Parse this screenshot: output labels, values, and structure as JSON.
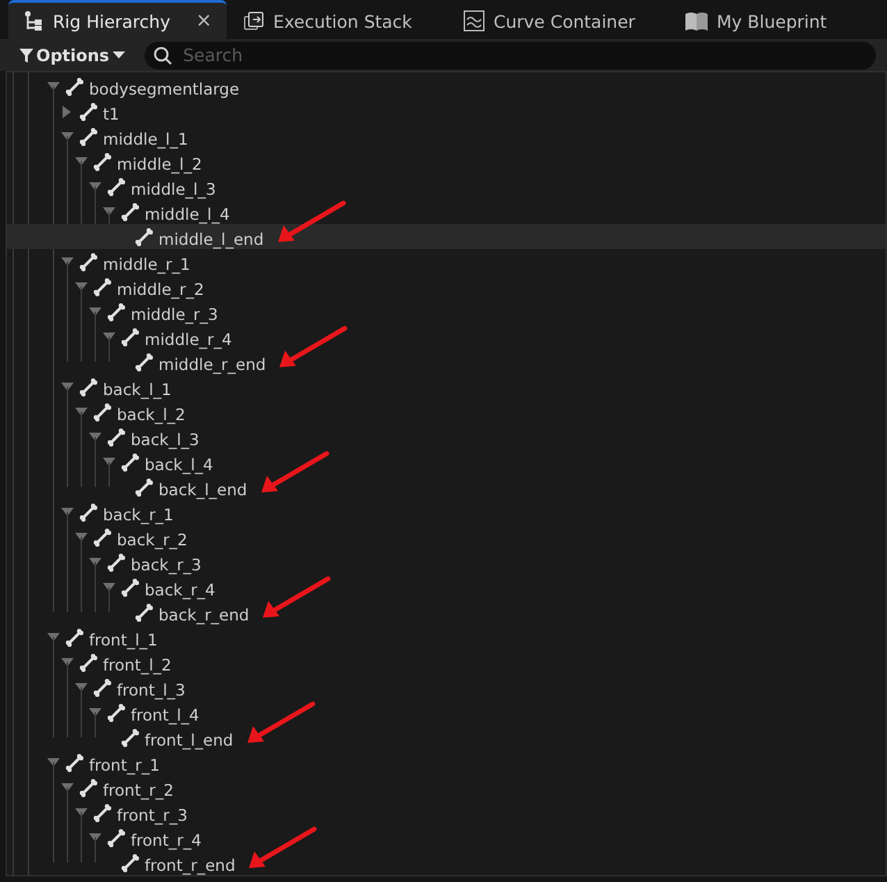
{
  "tabs": [
    {
      "label": "Rig Hierarchy",
      "selected": true,
      "close": "×"
    },
    {
      "label": "Execution Stack",
      "selected": false
    },
    {
      "label": "Curve Container",
      "selected": false
    },
    {
      "label": "My Blueprint",
      "selected": false
    }
  ],
  "toolbar": {
    "options": "Options",
    "search": {
      "placeholder": "Search"
    }
  },
  "tree": [
    {
      "label": "bodysegmentlarge",
      "expanded": true,
      "children": [
        {
          "label": "t1",
          "expanded": false
        },
        {
          "label": "middle_l_1",
          "expanded": true,
          "children": [
            {
              "label": "middle_l_2",
              "expanded": true,
              "children": [
                {
                  "label": "middle_l_3",
                  "expanded": true,
                  "children": [
                    {
                      "label": "middle_l_4",
                      "expanded": true,
                      "children": [
                        {
                          "label": "middle_l_end",
                          "selected": true,
                          "marked": true
                        }
                      ]
                    }
                  ]
                }
              ]
            }
          ]
        },
        {
          "label": "middle_r_1",
          "expanded": true,
          "children": [
            {
              "label": "middle_r_2",
              "expanded": true,
              "children": [
                {
                  "label": "middle_r_3",
                  "expanded": true,
                  "children": [
                    {
                      "label": "middle_r_4",
                      "expanded": true,
                      "children": [
                        {
                          "label": "middle_r_end",
                          "selected": false,
                          "marked": true
                        }
                      ]
                    }
                  ]
                }
              ]
            }
          ]
        },
        {
          "label": "back_l_1",
          "expanded": true,
          "children": [
            {
              "label": "back_l_2",
              "expanded": true,
              "children": [
                {
                  "label": "back_l_3",
                  "expanded": true,
                  "children": [
                    {
                      "label": "back_l_4",
                      "expanded": true,
                      "children": [
                        {
                          "label": "back_l_end",
                          "selected": false,
                          "marked": true
                        }
                      ]
                    }
                  ]
                }
              ]
            }
          ]
        },
        {
          "label": "back_r_1",
          "expanded": true,
          "children": [
            {
              "label": "back_r_2",
              "expanded": true,
              "children": [
                {
                  "label": "back_r_3",
                  "expanded": true,
                  "children": [
                    {
                      "label": "back_r_4",
                      "expanded": true,
                      "children": [
                        {
                          "label": "back_r_end",
                          "selected": false,
                          "marked": true
                        }
                      ]
                    }
                  ]
                }
              ]
            }
          ]
        }
      ]
    },
    {
      "label": "front_l_1",
      "expanded": true,
      "children": [
        {
          "label": "front_l_2",
          "expanded": true,
          "children": [
            {
              "label": "front_l_3",
              "expanded": true,
              "children": [
                {
                  "label": "front_l_4",
                  "expanded": true,
                  "children": [
                    {
                      "label": "front_l_end",
                      "selected": false,
                      "marked": true
                    }
                  ]
                }
              ]
            }
          ]
        }
      ]
    },
    {
      "label": "front_r_1",
      "expanded": true,
      "children": [
        {
          "label": "front_r_2",
          "expanded": true,
          "children": [
            {
              "label": "front_r_3",
              "expanded": true,
              "children": [
                {
                  "label": "front_r_4",
                  "expanded": true,
                  "children": [
                    {
                      "label": "front_r_end",
                      "selected": false,
                      "marked": true
                    }
                  ]
                }
              ]
            }
          ]
        }
      ]
    }
  ]
}
